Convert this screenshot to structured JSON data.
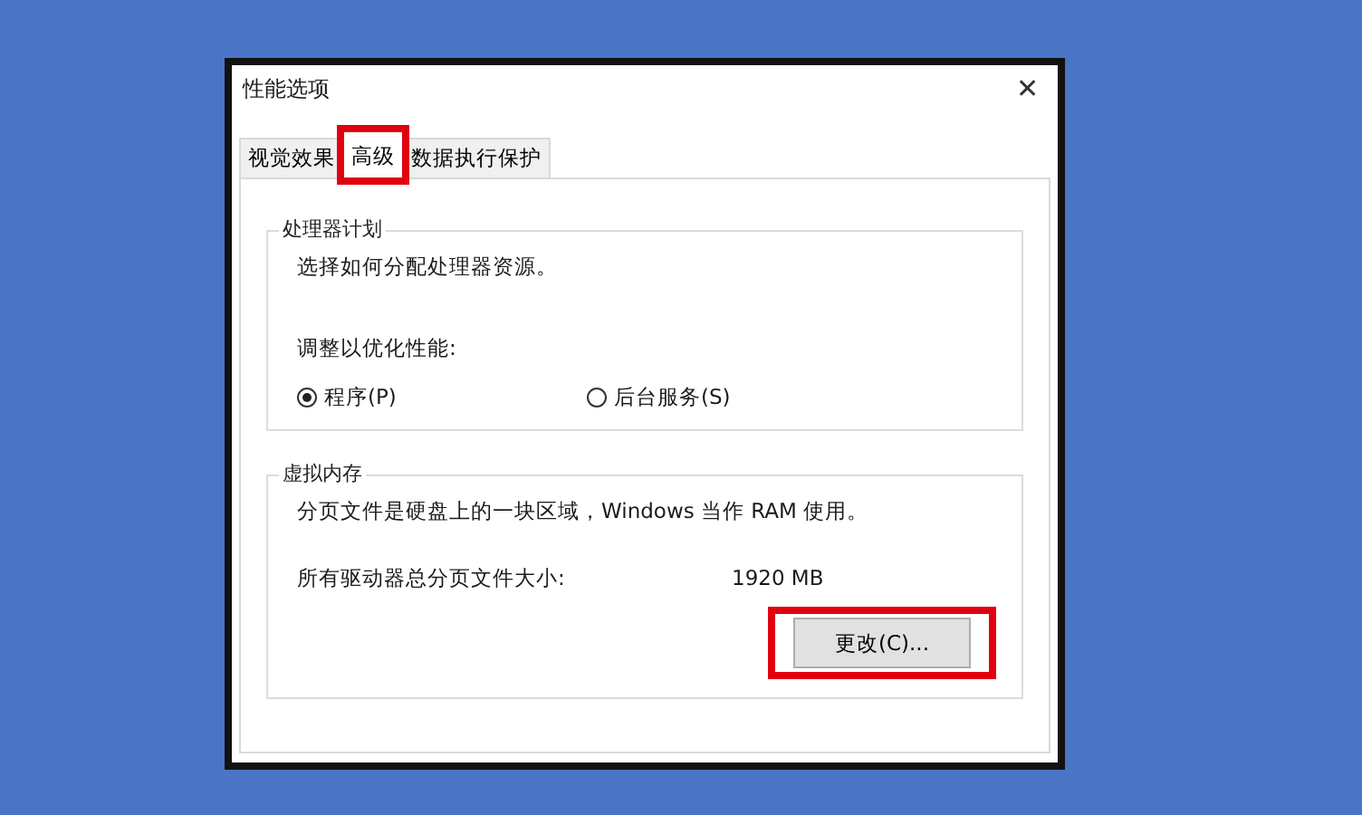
{
  "window": {
    "title": "性能选项",
    "close": "✕"
  },
  "tabs": [
    {
      "label": "视觉效果",
      "selected": false,
      "highlighted": false
    },
    {
      "label": "高级",
      "selected": true,
      "highlighted": true
    },
    {
      "label": "数据执行保护",
      "selected": false,
      "highlighted": false
    }
  ],
  "processor_group": {
    "title": "处理器计划",
    "description": "选择如何分配处理器资源。",
    "prompt": "调整以优化性能:",
    "options": [
      {
        "label": "程序(P)",
        "selected": true
      },
      {
        "label": "后台服务(S)",
        "selected": false
      }
    ]
  },
  "memory_group": {
    "title": "虚拟内存",
    "description": "分页文件是硬盘上的一块区域，Windows 当作 RAM 使用。",
    "size_label": "所有驱动器总分页文件大小:",
    "size_value": "1920 MB",
    "button": {
      "label": "更改(C)...",
      "highlighted": true
    }
  }
}
